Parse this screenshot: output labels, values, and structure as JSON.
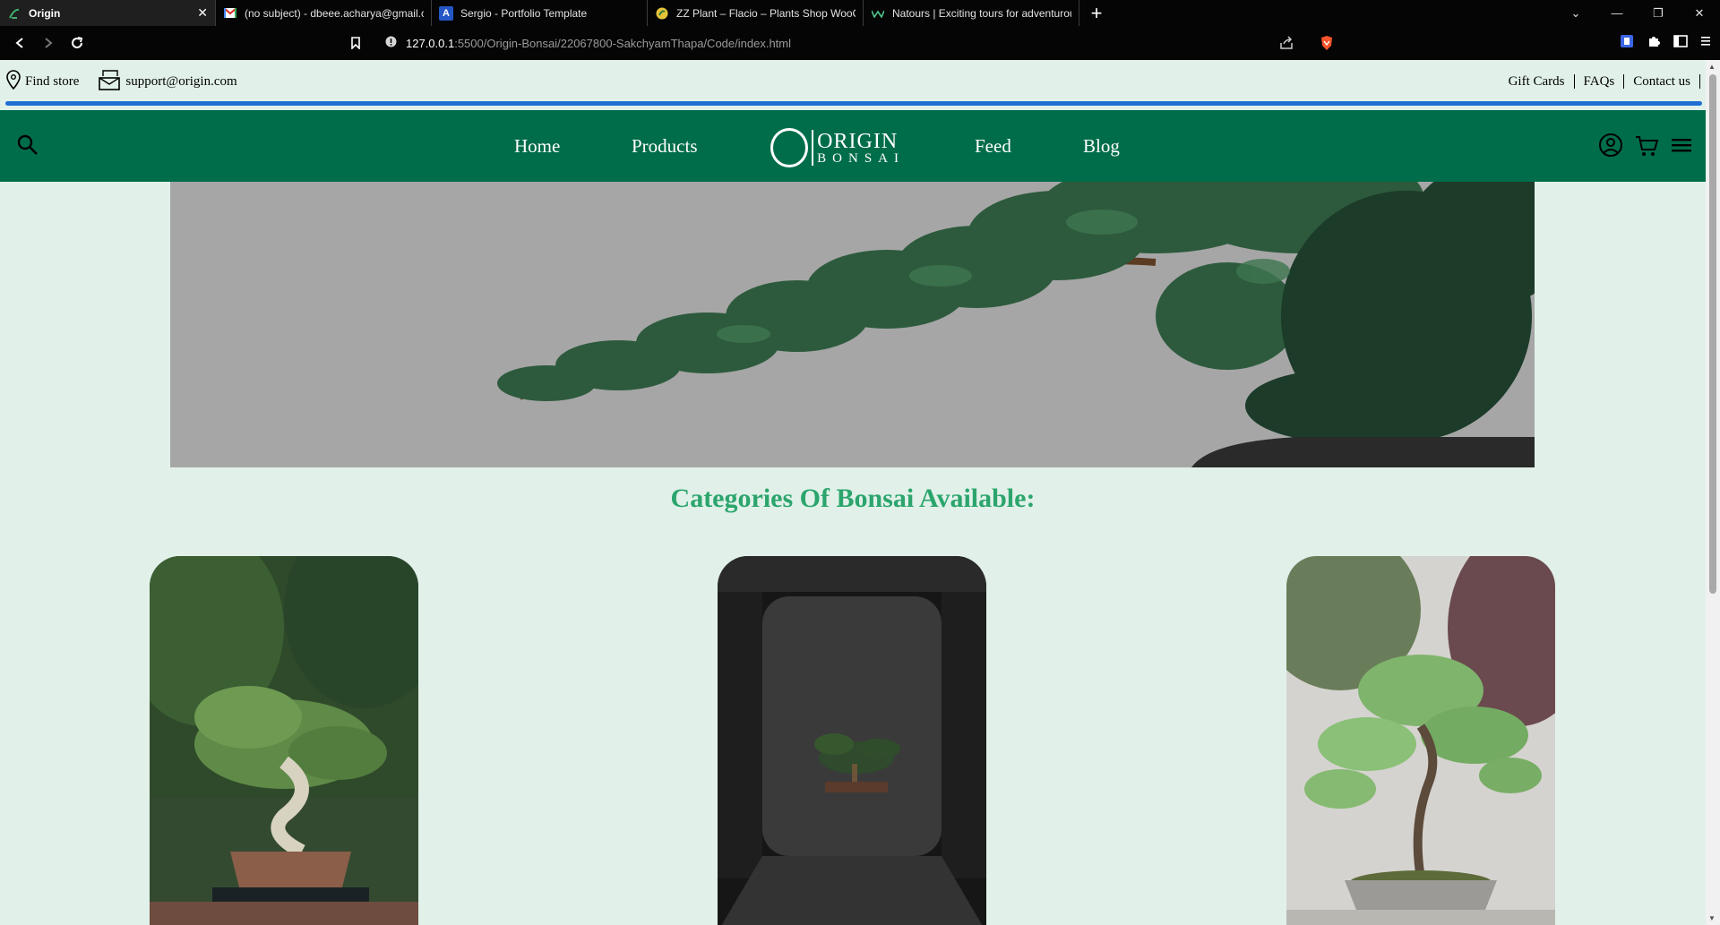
{
  "browser": {
    "tabs": [
      {
        "title": "Origin",
        "active": true,
        "favicon": "bonsai-favicon"
      },
      {
        "title": "(no subject) - dbeee.acharya@gmail.c",
        "active": false,
        "favicon": "gmail-icon"
      },
      {
        "title": "Sergio - Portfolio Template",
        "active": false,
        "favicon": "letter-a-icon"
      },
      {
        "title": "ZZ Plant – Flacio – Plants Shop WooCo",
        "active": false,
        "favicon": "plant-shop-icon"
      },
      {
        "title": "Natours | Exciting tours for adventurou",
        "active": false,
        "favicon": "natours-icon"
      }
    ],
    "new_tab_label": "+",
    "url_host": "127.0.0.1",
    "url_path": ":5500/Origin-Bonsai/22067800-SakchyamThapa/Code/index.html"
  },
  "topbar": {
    "find_store": "Find store",
    "email": "support@origin.com",
    "links": [
      "Gift Cards",
      "FAQs",
      "Contact us"
    ]
  },
  "nav": {
    "links": [
      "Home",
      "Products",
      "Feed",
      "Blog"
    ],
    "logo_top": "ORIGIN",
    "logo_bottom": "BONSAI"
  },
  "categories": {
    "title": "Categories Of Bonsai Available:"
  },
  "colors": {
    "page_bg": "#e1f1e9",
    "nav_bg": "#006d4a",
    "heading": "#2ca56d",
    "accent_line": "#1f6fd3"
  }
}
